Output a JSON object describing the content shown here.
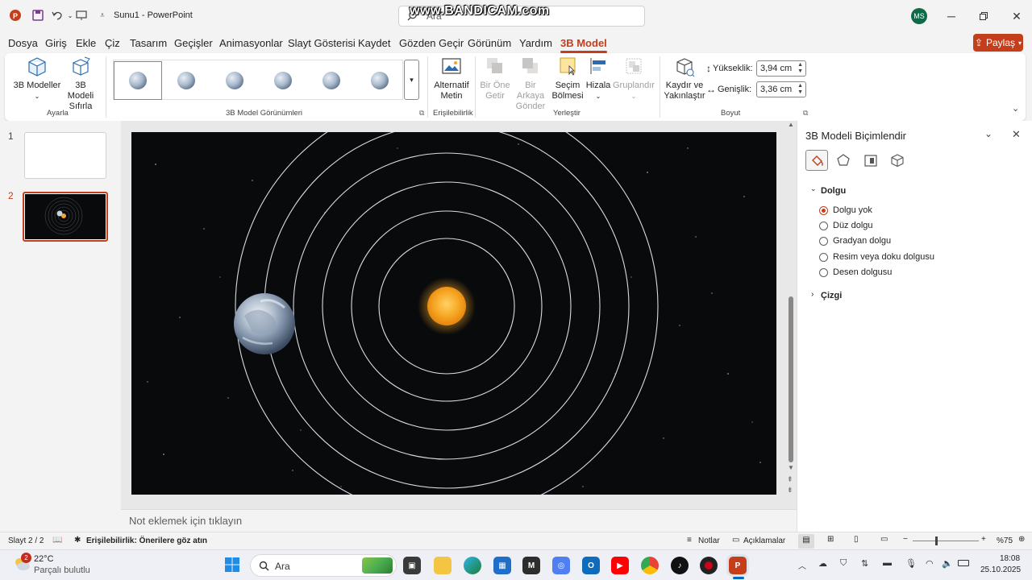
{
  "app": {
    "title": "Sunu1 - PowerPoint",
    "watermark": "www.BANDICAM.com",
    "search_placeholder": "Ara",
    "user_initials": "MS",
    "share_label": "Paylaş"
  },
  "menu": [
    "Dosya",
    "Giriş",
    "Ekle",
    "Çiz",
    "Tasarım",
    "Geçişler",
    "Animasyonlar",
    "Slayt Gösterisi",
    "Kaydet",
    "Gözden Geçir",
    "Görünüm",
    "Yardım",
    "3B Model"
  ],
  "ribbon": {
    "models_btn": "3B Modeller",
    "reset_btn_1": "3B Modeli",
    "reset_btn_2": "Sıfırla",
    "group_adjust": "Ayarla",
    "group_views": "3B Model Görünümleri",
    "alt_text_1": "Alternatif",
    "alt_text_2": "Metin",
    "group_access": "Erişilebilirlik",
    "bring_fwd_1": "Bir Öne",
    "bring_fwd_2": "Getir",
    "send_back_1": "Bir Arkaya",
    "send_back_2": "Gönder",
    "sel_pane_1": "Seçim",
    "sel_pane_2": "Bölmesi",
    "align": "Hizala",
    "group_btn": "Gruplandır",
    "group_arrange": "Yerleştir",
    "pan_zoom_1": "Kaydır ve",
    "pan_zoom_2": "Yakınlaştır",
    "height_label": "Yükseklik:",
    "height_value": "3,94 cm",
    "width_label": "Genişlik:",
    "width_value": "3,36 cm",
    "group_size": "Boyut"
  },
  "slides": {
    "n1": "1",
    "n2": "2"
  },
  "notes_placeholder": "Not eklemek için tıklayın",
  "pane": {
    "title": "3B Modeli Biçimlendir",
    "fill_section": "Dolgu",
    "options": [
      "Dolgu yok",
      "Düz dolgu",
      "Gradyan dolgu",
      "Resim veya doku dolgusu",
      "Desen dolgusu"
    ],
    "line_section": "Çizgi"
  },
  "status": {
    "slide_info": "Slayt 2 / 2",
    "accessibility": "Erişilebilirlik: Önerilere göz atın",
    "notes": "Notlar",
    "comments": "Açıklamalar",
    "zoom": "%75"
  },
  "taskbar": {
    "temp": "22°C",
    "weather": "Parçalı bulutlu",
    "weather_badge": "2",
    "search": "Ara",
    "time": "18:08",
    "date": "25.10.2025"
  },
  "colors": {
    "accent": "#c43e1c",
    "sun": "#f6a623"
  }
}
